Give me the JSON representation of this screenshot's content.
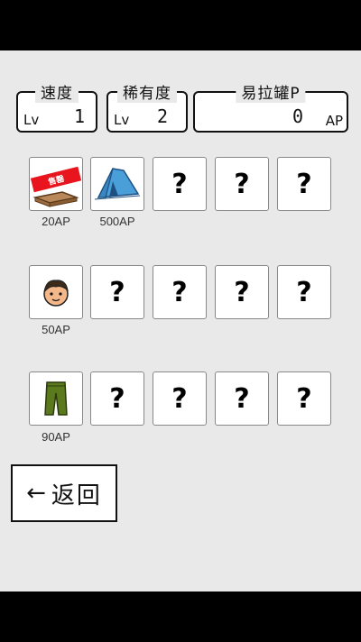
{
  "stats": {
    "speed": {
      "title": "速度",
      "lv_label": "Lv",
      "value": "1"
    },
    "rarity": {
      "title": "稀有度",
      "lv_label": "Lv",
      "value": "2"
    },
    "cans": {
      "title": "易拉罐P",
      "value": "0",
      "unit": "AP"
    }
  },
  "rows": [
    {
      "items": [
        {
          "icon": "sale-ramen-icon",
          "locked": false,
          "price": "20AP",
          "badge": "售罄"
        },
        {
          "icon": "tent-icon",
          "locked": false,
          "price": "500AP"
        },
        {
          "icon": "question-icon",
          "locked": true,
          "price": ""
        },
        {
          "icon": "question-icon",
          "locked": true,
          "price": ""
        },
        {
          "icon": "question-icon",
          "locked": true,
          "price": ""
        }
      ]
    },
    {
      "items": [
        {
          "icon": "face-icon",
          "locked": false,
          "price": "50AP"
        },
        {
          "icon": "question-icon",
          "locked": true,
          "price": ""
        },
        {
          "icon": "question-icon",
          "locked": true,
          "price": ""
        },
        {
          "icon": "question-icon",
          "locked": true,
          "price": ""
        },
        {
          "icon": "question-icon",
          "locked": true,
          "price": ""
        }
      ]
    },
    {
      "items": [
        {
          "icon": "pants-icon",
          "locked": false,
          "price": "90AP"
        },
        {
          "icon": "question-icon",
          "locked": true,
          "price": ""
        },
        {
          "icon": "question-icon",
          "locked": true,
          "price": ""
        },
        {
          "icon": "question-icon",
          "locked": true,
          "price": ""
        },
        {
          "icon": "question-icon",
          "locked": true,
          "price": ""
        }
      ]
    }
  ],
  "unknown_mark": "?",
  "back_button": {
    "arrow": "←",
    "label": "返回"
  },
  "colors": {
    "background": "#e9e9e9",
    "tent": "#4a9fd8",
    "pants": "#5b7a1e",
    "sale_banner": "#e8141e"
  }
}
